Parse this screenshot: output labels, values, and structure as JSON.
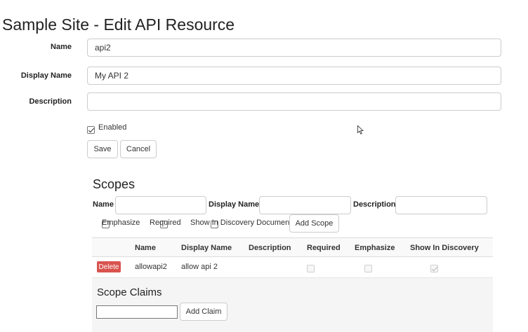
{
  "page": {
    "title": "Sample Site - Edit API Resource"
  },
  "form": {
    "name_label": "Name",
    "name_value": "api2",
    "display_name_label": "Display Name",
    "display_name_value": "My API 2",
    "description_label": "Description",
    "description_value": "",
    "enabled_label": "Enabled",
    "enabled_checked": true,
    "save_label": "Save",
    "cancel_label": "Cancel"
  },
  "scopes": {
    "title": "Scopes",
    "add": {
      "name_label": "Name",
      "display_name_label": "Display Name",
      "description_label": "Description",
      "emphasize_label": "Emphasize",
      "required_label": "Required",
      "show_in_discovery_label": "Show In Discovery Document",
      "add_scope_label": "Add Scope"
    },
    "table": {
      "columns": [
        "Name",
        "Display Name",
        "Description",
        "Required",
        "Emphasize",
        "Show In Discovery"
      ],
      "rows": [
        {
          "delete_label": "Delete",
          "name": "allowapi2",
          "display_name": "allow api 2",
          "description": "",
          "required": false,
          "emphasize": false,
          "show_in_discovery": true
        }
      ]
    },
    "claims": {
      "title": "Scope Claims",
      "input_value": "",
      "add_claim_label": "Add Claim"
    }
  },
  "colors": {
    "delete_button": "#d9534f",
    "table_header_bg": "#f9f9f9",
    "claims_panel_bg": "#f5f5f5",
    "input_border": "#cccccc"
  }
}
